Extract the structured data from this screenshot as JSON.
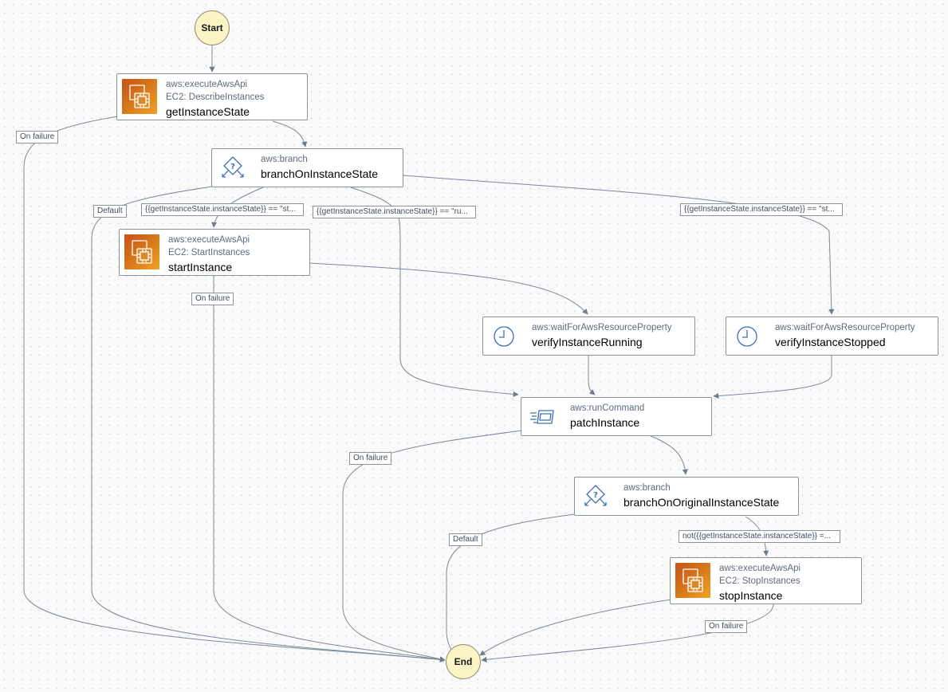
{
  "start": "Start",
  "end": "End",
  "nodes": {
    "getInstanceState": {
      "action": "aws:executeAwsApi",
      "sub": "EC2: DescribeInstances",
      "name": "getInstanceState"
    },
    "branchOnInstanceState": {
      "action": "aws:branch",
      "name": "branchOnInstanceState"
    },
    "startInstance": {
      "action": "aws:executeAwsApi",
      "sub": "EC2: StartInstances",
      "name": "startInstance"
    },
    "verifyInstanceRunning": {
      "action": "aws:waitForAwsResourceProperty",
      "name": "verifyInstanceRunning"
    },
    "verifyInstanceStopped": {
      "action": "aws:waitForAwsResourceProperty",
      "name": "verifyInstanceStopped"
    },
    "patchInstance": {
      "action": "aws:runCommand",
      "name": "patchInstance"
    },
    "branchOnOriginalInstanceState": {
      "action": "aws:branch",
      "name": "branchOnOriginalInstanceState"
    },
    "stopInstance": {
      "action": "aws:executeAwsApi",
      "sub": "EC2: StopInstances",
      "name": "stopInstance"
    }
  },
  "edge_labels": {
    "on_failure": "On failure",
    "default": "Default",
    "cond_stopped": "{{getInstanceState.instanceState}} == \"st...",
    "cond_running": "{{getInstanceState.instanceState}} == \"ru...",
    "cond_stopped_2": "{{getInstanceState.instanceState}} == \"st...",
    "cond_not": "not({{getInstanceState.instanceState}} =..."
  },
  "icons": {
    "ec2": "ec2-chip-icon",
    "branch": "branch-icon",
    "wait": "clock-icon",
    "runCommand": "run-command-icon"
  },
  "colors": {
    "start_end_fill": "#fbf5c6",
    "icon_orange": "#d4751a",
    "icon_blue": "#3f6fb5",
    "edge": "#7d8998"
  }
}
